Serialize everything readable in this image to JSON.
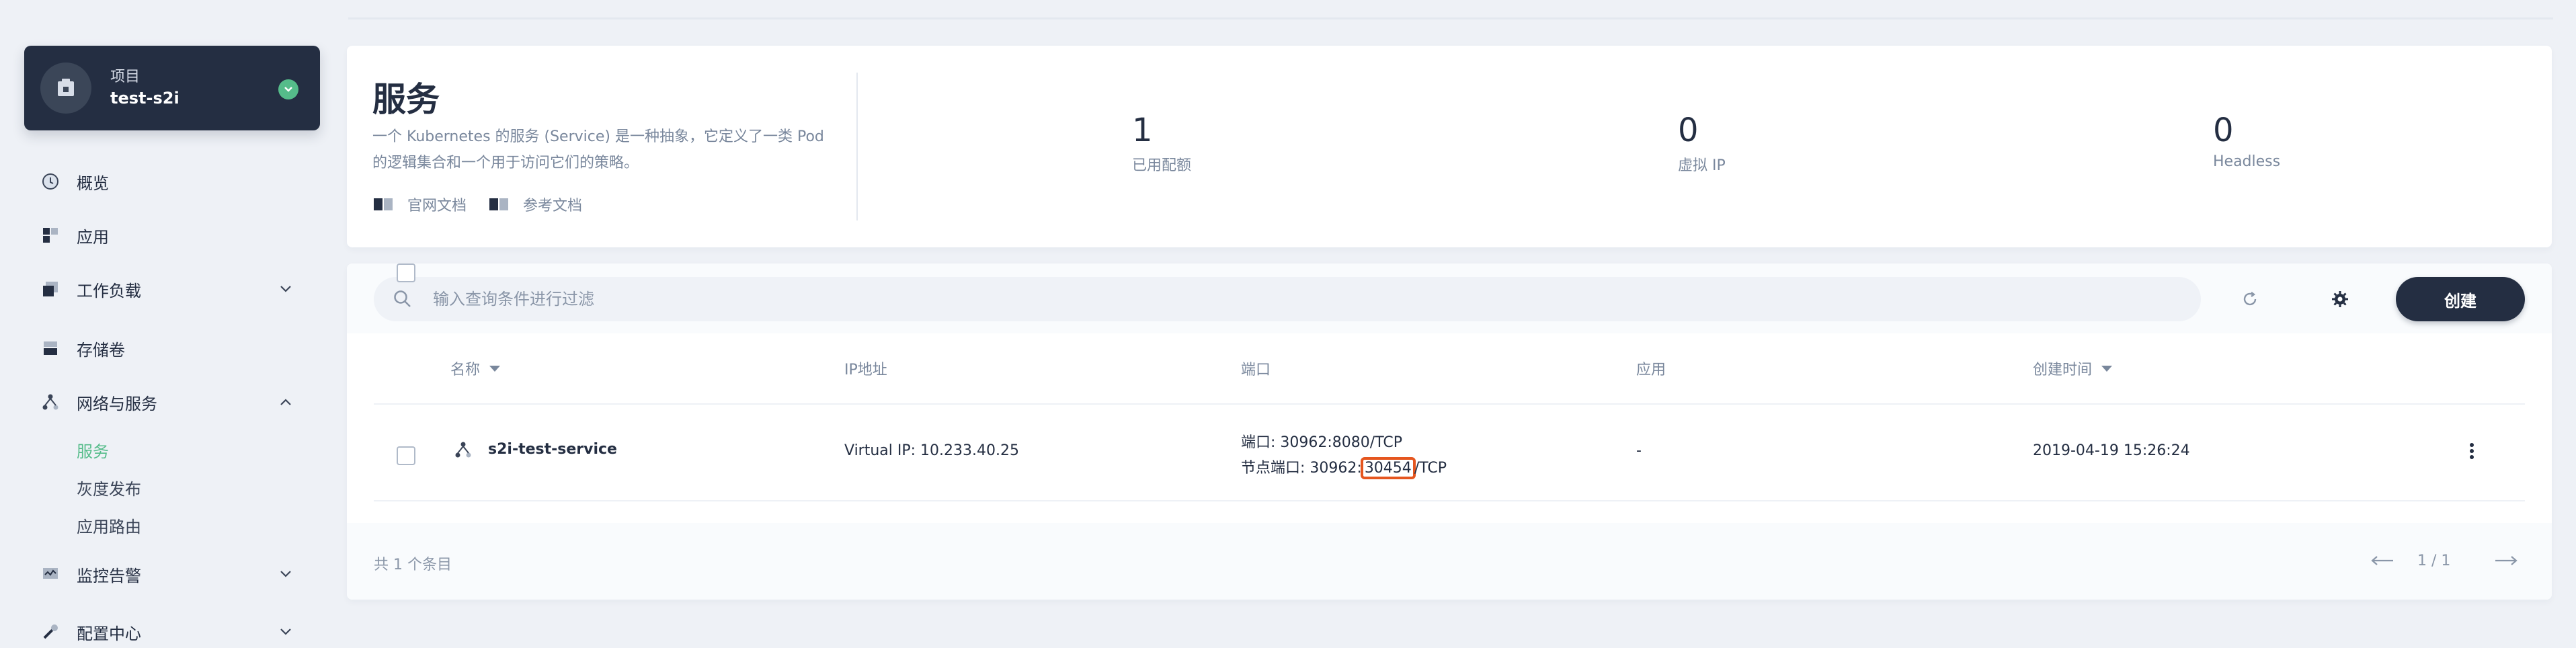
{
  "project": {
    "kicker": "项目",
    "name": "test-s2i"
  },
  "nav": [
    {
      "label": "概览",
      "icon": "dashboard-icon"
    },
    {
      "label": "应用",
      "icon": "apps-icon"
    },
    {
      "label": "工作负载",
      "icon": "workload-icon"
    },
    {
      "label": "存储卷",
      "icon": "storage-icon"
    },
    {
      "label": "网络与服务",
      "icon": "network-icon"
    },
    {
      "label": "监控告警",
      "icon": "monitor-icon"
    },
    {
      "label": "配置中心",
      "icon": "config-icon"
    }
  ],
  "subnav": [
    {
      "label": "服务",
      "active": true
    },
    {
      "label": "灰度发布"
    },
    {
      "label": "应用路由"
    }
  ],
  "header": {
    "title": "服务",
    "description": "一个 Kubernetes 的服务 (Service) 是一种抽象，它定义了一类 Pod 的逻辑集合和一个用于访问它们的策略。",
    "links": [
      "官网文档",
      "参考文档"
    ],
    "stats": [
      {
        "value": "1",
        "label": "已用配额"
      },
      {
        "value": "0",
        "label": "虚拟 IP"
      },
      {
        "value": "0",
        "label": "Headless"
      }
    ]
  },
  "search": {
    "placeholder": "输入查询条件进行过滤"
  },
  "toolbar": {
    "create_label": "创建"
  },
  "table": {
    "columns": [
      "名称",
      "IP地址",
      "端口",
      "应用",
      "创建时间"
    ],
    "rows": [
      {
        "name": "s2i-test-service",
        "ip": "Virtual IP: 10.233.40.25",
        "port_line1": "端口: 30962:8080/TCP",
        "port_line2_prefix": "节点端口: 30962:",
        "port_line2_highlight": "30454",
        "port_line2_suffix": "/TCP",
        "app": "-",
        "created": "2019-04-19 15:26:24"
      }
    ],
    "total": "共 1 个条目",
    "page": "1 / 1"
  },
  "colors": {
    "accent_green": "#55bc8a",
    "dark": "#242e42",
    "highlight": "#e5561f"
  }
}
